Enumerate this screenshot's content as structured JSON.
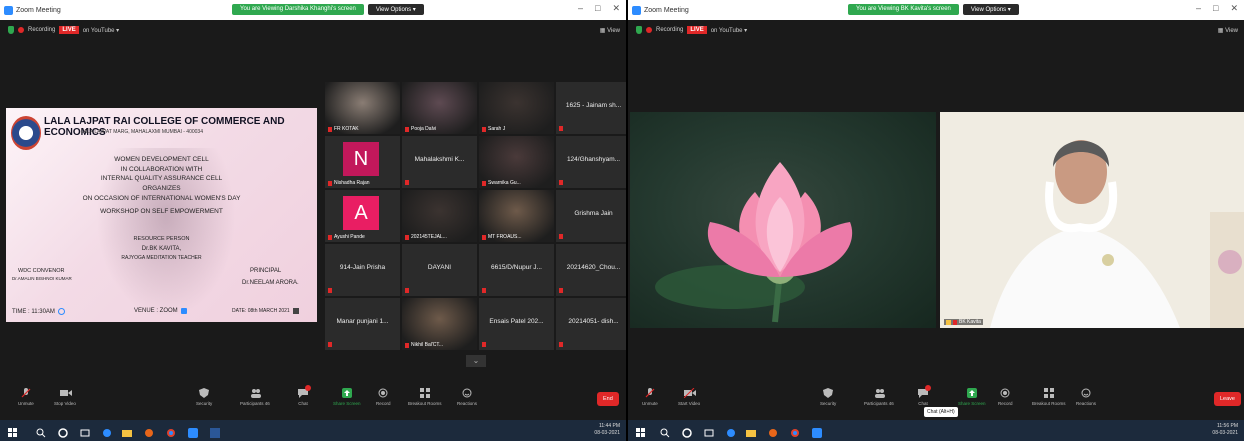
{
  "left_window": {
    "title": "Zoom Meeting",
    "viewing_banner": "You are Viewing Darshika Khanghi's screen",
    "view_options": "View Options",
    "recording": "Recording",
    "live_badge": "LIVE",
    "live_target": "on YouTube",
    "view_label": "View",
    "poster": {
      "college": "LALA LAJPAT RAI COLLEGE OF COMMERCE AND ECONOMICS",
      "address": "LALA LAJPAT MARG, MAHALAXMI MUMBAI - 400034",
      "lines": [
        "WOMEN DEVELOPMENT CELL",
        "IN COLLABORATION WITH",
        "INTERNAL QUALITY ASSURANCE CELL",
        "ORGANIZES",
        "ON OCCASION OF INTERNATIONAL WOMEN'S DAY",
        "WORKSHOP ON SELF EMPOWERMENT"
      ],
      "resource_label": "RESOURCE PERSON",
      "resource_name": "Dr.BK KAVITA,",
      "resource_title": "RAJYOGA MEDITATION TEACHER",
      "convenor_label": "WDC CONVENOR",
      "convenor_name": "Dr.AMALIN BISHNOI KUMAR",
      "principal_label": "PRINCIPAL",
      "principal_name": "Dr.NEELAM ARORA.",
      "time": "TIME : 11:30AM",
      "venue": "VENUE : ZOOM",
      "date": "DATE: 08th MARCH 2021"
    },
    "gallery": [
      {
        "name": "FR KOTAK",
        "kind": "video"
      },
      {
        "name": "Pooja Dalvi",
        "kind": "video"
      },
      {
        "name": "Sarah J",
        "kind": "video",
        "active": true
      },
      {
        "name": "1625 - Jainam sh...",
        "kind": "text"
      },
      {
        "name": "Nishadha Rajan",
        "kind": "initial",
        "initial": "N",
        "color": "#c2185b"
      },
      {
        "name": "Mahalakshmi K...",
        "kind": "text"
      },
      {
        "name": "Swarnika Gu...",
        "kind": "video"
      },
      {
        "name": "124/Ghanshyam...",
        "kind": "text"
      },
      {
        "name": "Ayushi Pande",
        "kind": "initial",
        "initial": "A",
        "color": "#e91e63"
      },
      {
        "name": "202145TEJAL...",
        "kind": "video"
      },
      {
        "name": "MT FROAUS...",
        "kind": "video"
      },
      {
        "name": "Grishma Jain",
        "kind": "text"
      },
      {
        "name": "914-Jain Prisha",
        "kind": "text"
      },
      {
        "name": "DAYANI",
        "kind": "text"
      },
      {
        "name": "6615/D/Nupur J...",
        "kind": "text"
      },
      {
        "name": "20214620_Chou...",
        "kind": "text"
      },
      {
        "name": "Manar punjani 1...",
        "kind": "text"
      },
      {
        "name": "Nikhil Bal'CT...",
        "kind": "video"
      },
      {
        "name": "Ensais Patel 202...",
        "kind": "text"
      },
      {
        "name": "20214051- dish...",
        "kind": "text"
      }
    ],
    "toolbar": {
      "unmute": "Unmute",
      "stop_video": "Stop Video",
      "security": "Security",
      "participants": "Participants",
      "participants_count": "46",
      "chat": "Chat",
      "share_screen": "Share Screen",
      "record": "Record",
      "breakout": "Breakout Rooms",
      "reactions": "Reactions",
      "end": "End"
    },
    "taskbar": {
      "time": "11:44 PM",
      "date": "08-03-2021"
    }
  },
  "right_window": {
    "title": "Zoom Meeting",
    "viewing_banner": "You are Viewing BK Kavita's screen",
    "view_options": "View Options",
    "recording": "Recording",
    "live_badge": "LIVE",
    "live_target": "on YouTube",
    "view_label": "View",
    "speaker_name": "BK Kavita",
    "toolbar": {
      "unmute": "Unmute",
      "stop_video": "Start Video",
      "security": "Security",
      "participants": "Participants",
      "participants_count": "46",
      "chat": "Chat",
      "chat_tooltip": "Chat (Alt+H)",
      "share_screen": "Share Screen",
      "record": "Record",
      "breakout": "Breakout Rooms",
      "reactions": "Reactions",
      "end": "Leave"
    },
    "taskbar": {
      "time": "11:56 PM",
      "date": "08-03-2021"
    }
  },
  "colors": {
    "zoom_blue": "#2d8cff",
    "live_red": "#e02828",
    "viewing_green": "#2fa84f",
    "active_speaker": "#b5e61d",
    "taskbar": "#1c2a3c"
  }
}
